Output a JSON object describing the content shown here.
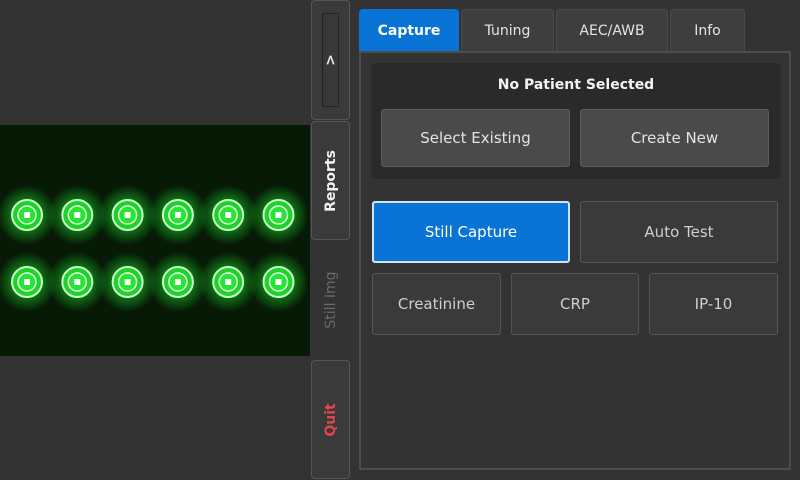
{
  "side": {
    "collapse_label": ">",
    "reports_label": "Reports",
    "still_img_label": "Still Img",
    "quit_label": "Quit"
  },
  "tabs": [
    {
      "label": "Capture",
      "active": true
    },
    {
      "label": "Tuning",
      "active": false
    },
    {
      "label": "AEC/AWB",
      "active": false
    },
    {
      "label": "Info",
      "active": false
    }
  ],
  "patient": {
    "status": "No Patient Selected",
    "select_label": "Select Existing",
    "create_label": "Create New"
  },
  "capture": {
    "still_capture_label": "Still Capture",
    "auto_test_label": "Auto Test",
    "tests": [
      {
        "label": "Creatinine"
      },
      {
        "label": "CRP"
      },
      {
        "label": "IP-10"
      }
    ]
  },
  "preview": {
    "led_color": "#22ff33",
    "rows": 2,
    "columns": 6
  },
  "colors": {
    "accent": "#0a74d6",
    "quit": "#e0464a",
    "background": "#333333"
  }
}
